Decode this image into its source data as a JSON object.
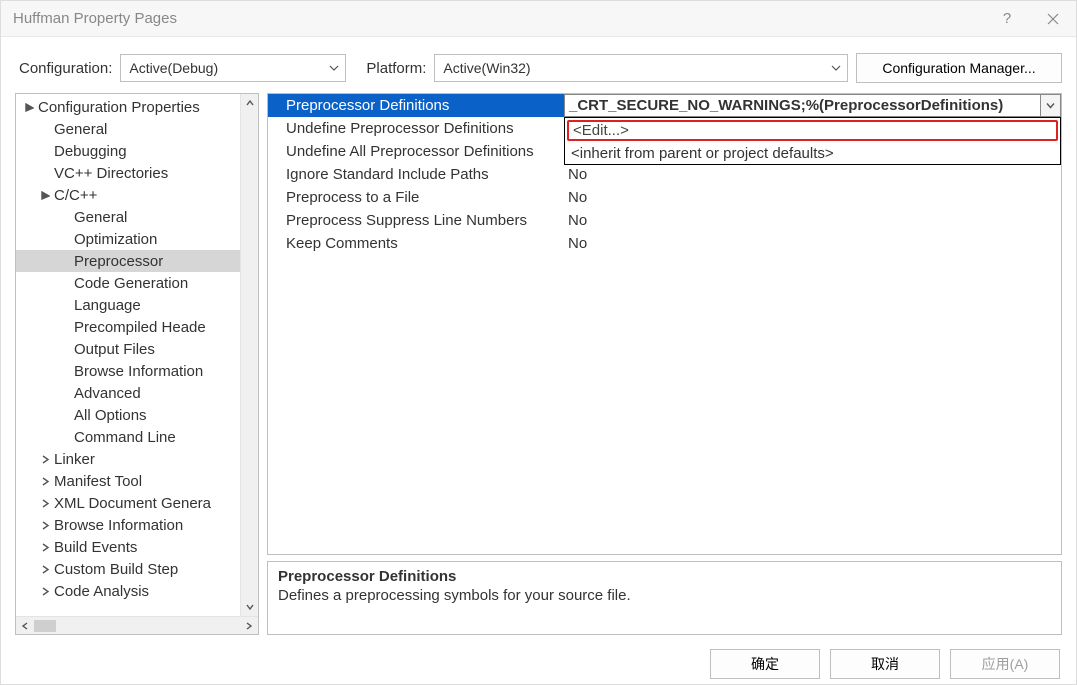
{
  "window": {
    "title": "Huffman Property Pages"
  },
  "top": {
    "config_label": "Configuration:",
    "config_value": "Active(Debug)",
    "platform_label": "Platform:",
    "platform_value": "Active(Win32)",
    "config_manager": "Configuration Manager..."
  },
  "tree": {
    "root": "Configuration Properties",
    "items": [
      "General",
      "Debugging",
      "VC++ Directories"
    ],
    "ccpp": {
      "label": "C/C++",
      "children": [
        "General",
        "Optimization",
        "Preprocessor",
        "Code Generation",
        "Language",
        "Precompiled Heade",
        "Output Files",
        "Browse Information",
        "Advanced",
        "All Options",
        "Command Line"
      ],
      "selected_index": 2
    },
    "rest": [
      "Linker",
      "Manifest Tool",
      "XML Document Genera",
      "Browse Information",
      "Build Events",
      "Custom Build Step",
      "Code Analysis"
    ]
  },
  "grid": {
    "rows": [
      {
        "name": "Preprocessor Definitions",
        "value": "_CRT_SECURE_NO_WARNINGS;%(PreprocessorDefinitions)",
        "selected": true,
        "dropdown": true
      },
      {
        "name": "Undefine Preprocessor Definitions",
        "value": ""
      },
      {
        "name": "Undefine All Preprocessor Definitions",
        "value": ""
      },
      {
        "name": "Ignore Standard Include Paths",
        "value": "No"
      },
      {
        "name": "Preprocess to a File",
        "value": "No"
      },
      {
        "name": "Preprocess Suppress Line Numbers",
        "value": "No"
      },
      {
        "name": "Keep Comments",
        "value": "No"
      }
    ],
    "dropdown_options": [
      "<Edit...>",
      "<inherit from parent or project defaults>"
    ]
  },
  "description": {
    "title": "Preprocessor Definitions",
    "text": "Defines a preprocessing symbols for your source file."
  },
  "footer": {
    "ok": "确定",
    "cancel": "取消",
    "apply": "应用(A)"
  }
}
